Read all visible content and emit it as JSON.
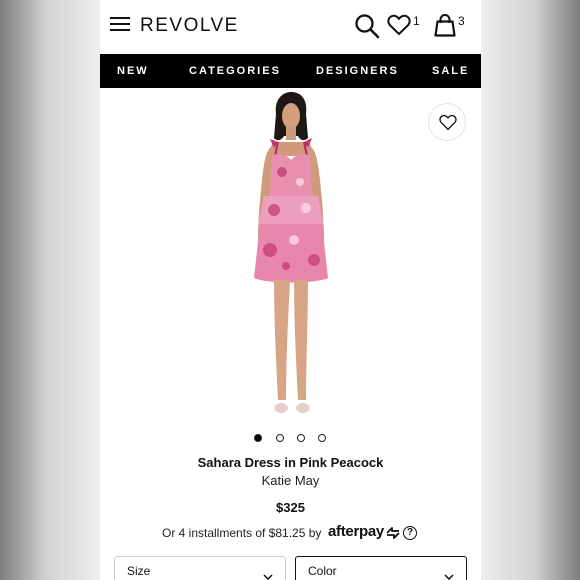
{
  "header": {
    "logo": "REVOLVE",
    "wishlist_count": "1",
    "bag_count": "3"
  },
  "nav": {
    "items": [
      "NEW",
      "CATEGORIES",
      "DESIGNERS",
      "SALE"
    ]
  },
  "product": {
    "title": "Sahara Dress in Pink Peacock",
    "brand": "Katie May",
    "price": "$325",
    "installments_text": "Or 4 installments of $81.25 by",
    "payment_provider": "afterpay",
    "info_glyph": "?",
    "image_count": 4,
    "active_image_index": 0
  },
  "selectors": {
    "size_label": "Size",
    "color_label": "Color"
  },
  "icons": {
    "menu": "hamburger-menu-icon",
    "search": "search-icon",
    "wishlist": "heart-icon",
    "bag": "shopping-bag-icon",
    "afterpay_mark": "afterpay-arrows-icon"
  },
  "colors": {
    "nav_background": "#000000",
    "nav_text": "#ffffff",
    "dress_pink": "#e98fb0",
    "dress_accent": "#c2386e"
  }
}
